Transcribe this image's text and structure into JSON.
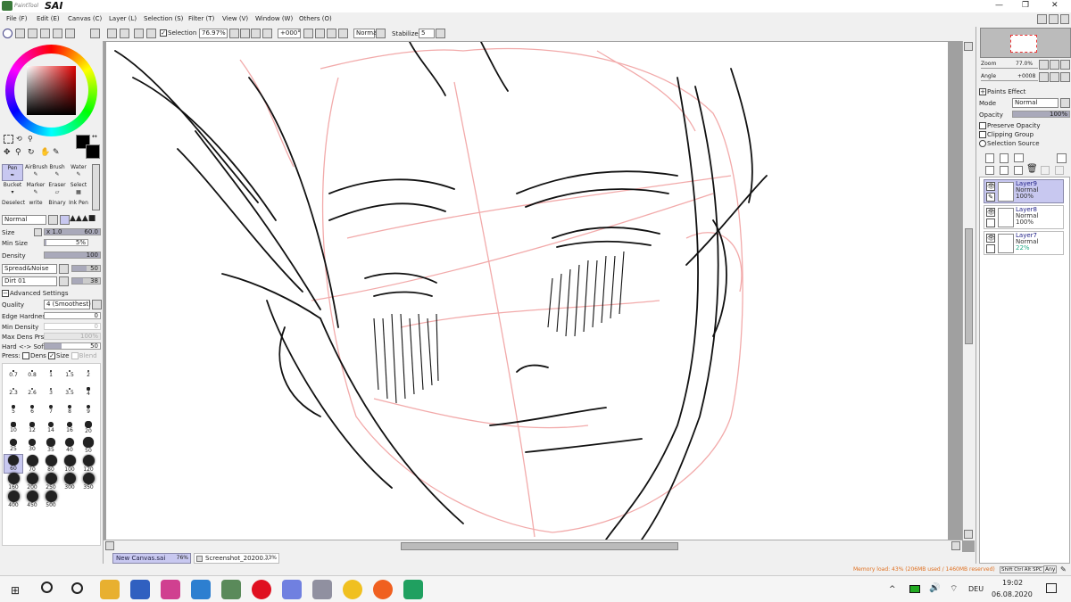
{
  "app": {
    "title": "PaintTool SAI",
    "logo_small": "PaintTool",
    "logo_big": "SAI"
  },
  "window_controls": {
    "minimize": "—",
    "restore": "❐",
    "close": "✕"
  },
  "menu": [
    {
      "label": "File (F)"
    },
    {
      "label": "Edit (E)"
    },
    {
      "label": "Canvas (C)"
    },
    {
      "label": "Layer (L)"
    },
    {
      "label": "Selection (S)"
    },
    {
      "label": "Filter (T)"
    },
    {
      "label": "View (V)"
    },
    {
      "label": "Window (W)"
    },
    {
      "label": "Others (O)"
    }
  ],
  "toolbar": {
    "selection_label": "Selection",
    "zoom": "76.97%",
    "angle": "+000°",
    "blend": "Normal",
    "stabilizer_label": "Stabilizer",
    "stabilizer_value": "5"
  },
  "tools": [
    {
      "label": "Pen"
    },
    {
      "label": "AirBrush"
    },
    {
      "label": "Brush"
    },
    {
      "label": "Water"
    },
    {
      "label": "Bucket"
    },
    {
      "label": "Marker"
    },
    {
      "label": "Eraser"
    },
    {
      "label": "Select"
    },
    {
      "label": "Deselect"
    },
    {
      "label": "write"
    },
    {
      "label": "Binary"
    },
    {
      "label": "Ink Pen"
    }
  ],
  "brush_settings": {
    "mode": "Normal",
    "size_label": "Size",
    "size_mult": "x 1.0",
    "size_value": "60.0",
    "min_size_label": "Min Size",
    "min_size_value": "5%",
    "min_size_level": 0.05,
    "density_label": "Density",
    "density_value": "100",
    "density_level": 1.0,
    "texture1": "Spread&Noise",
    "texture1_value": "50",
    "texture2": "Dirt 01",
    "texture2_value": "38",
    "advanced_label": "Advanced Settings",
    "quality_label": "Quality",
    "quality_value": "4 (Smoothest)",
    "edge_label": "Edge Hardness",
    "edge_value": "0",
    "min_dens_label": "Min Density",
    "min_dens_value": "0",
    "max_dens_label": "Max Dens Prs.",
    "max_dens_value": "100%",
    "hard_soft_label": "Hard <-> Soft",
    "hard_soft_value": "50",
    "press_label": "Press:",
    "press_dens": "Dens",
    "press_size": "Size",
    "press_blend": "Blend"
  },
  "brush_sizes": [
    "0.7",
    "0.8",
    "1",
    "1.5",
    "2",
    "2.3",
    "2.6",
    "3",
    "3.5",
    "4",
    "5",
    "6",
    "7",
    "8",
    "9",
    "10",
    "12",
    "14",
    "16",
    "20",
    "25",
    "30",
    "35",
    "40",
    "50",
    "60",
    "70",
    "80",
    "100",
    "120",
    "160",
    "200",
    "250",
    "300",
    "350",
    "400",
    "450",
    "500"
  ],
  "navigator": {
    "zoom_label": "Zoom",
    "zoom_value": "77.0%",
    "angle_label": "Angle",
    "angle_value": "+0008"
  },
  "layer_panel": {
    "paints_effect": "Paints Effect",
    "mode_label": "Mode",
    "mode_value": "Normal",
    "opacity_label": "Opacity",
    "opacity_value": "100%",
    "preserve_opacity": "Preserve Opacity",
    "clipping_group": "Clipping Group",
    "selection_source": "Selection Source"
  },
  "layers": [
    {
      "name": "Layer9",
      "mode": "Normal",
      "opacity": "100%"
    },
    {
      "name": "Layer8",
      "mode": "Normal",
      "opacity": "100%"
    },
    {
      "name": "Layer7",
      "mode": "Normal",
      "opacity": "22%"
    }
  ],
  "tabs": [
    {
      "name": "New Canvas.sai",
      "zoom": "76%"
    },
    {
      "name": "Screenshot_20200...",
      "zoom": "33%"
    }
  ],
  "status": {
    "memory": "Memory load: 43% (206MB used / 1460MB reserved)",
    "keys": "Shift Ctrl Alt SPC",
    "any": "Any"
  },
  "taskbar": {
    "time": "19:02",
    "date": "06.08.2020",
    "lang": "DEU",
    "apps": [
      "file-explorer-icon",
      "store-icon",
      "paint-app-icon",
      "vscode-icon",
      "sai-icon",
      "opera-icon",
      "discord-icon",
      "paint-palette-icon",
      "chrome-icon",
      "firefox-icon",
      "screenshot-icon"
    ]
  },
  "colors": {
    "accent_selection": "#c8c8f0",
    "memory_text": "#e07020",
    "sketch_red": "#f0a0a0"
  }
}
